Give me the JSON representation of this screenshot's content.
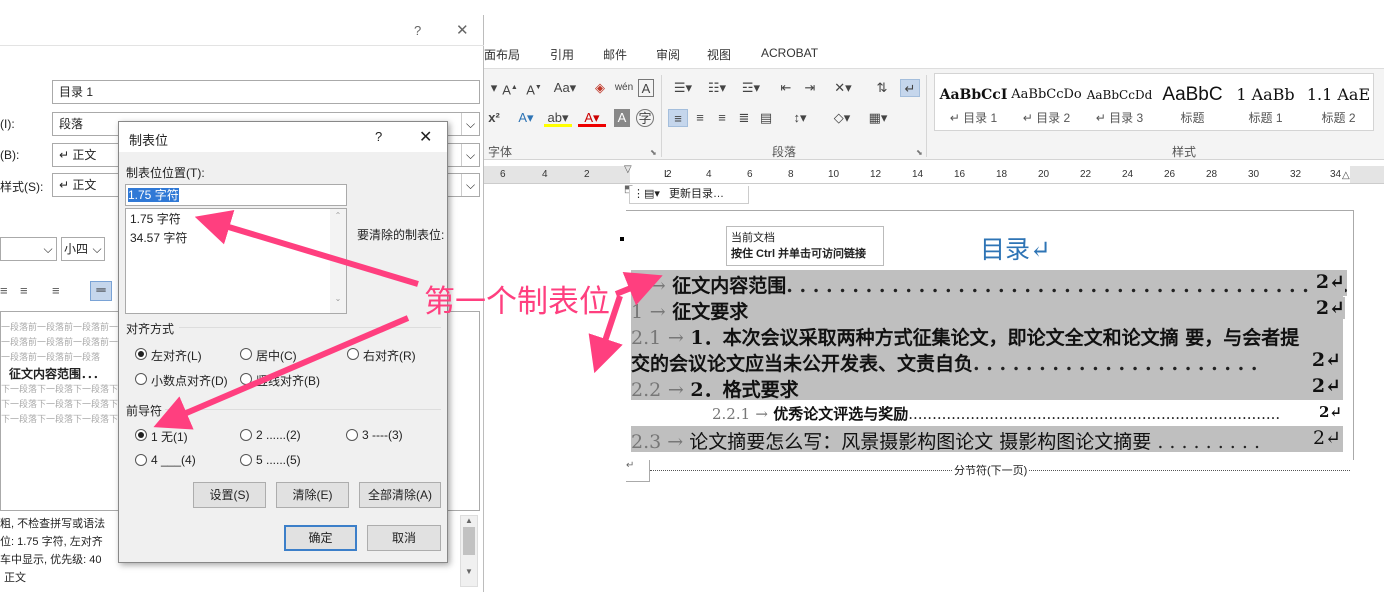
{
  "word": {
    "tabs": [
      "面布局",
      "引用",
      "邮件",
      "审阅",
      "视图",
      "ACROBAT"
    ],
    "group_labels": {
      "font": "字体",
      "paragraph": "段落",
      "styles": "样式"
    },
    "styles": [
      {
        "preview": "AaBbCcI",
        "name": "↵ 目录 1"
      },
      {
        "preview": "AaBbCcDo",
        "name": "↵ 目录 2"
      },
      {
        "preview": "AaBbCcDd",
        "name": "↵ 目录 3"
      },
      {
        "preview": "AaBbC",
        "name": "标题"
      },
      {
        "preview": "1 AaBb",
        "name": "标题 1"
      },
      {
        "preview": "1.1 AaE",
        "name": "标题 2"
      }
    ],
    "ruler_ticks": [
      "6",
      "4",
      "2",
      "2",
      "4",
      "6",
      "8",
      "10",
      "12",
      "14",
      "16",
      "18",
      "20",
      "22",
      "24",
      "26",
      "28",
      "30",
      "32",
      "34"
    ],
    "field_toolbar": "更新目录…",
    "tooltip_line1": "当前文档",
    "tooltip_line2": "按住 Ctrl 并单击可访问链接",
    "doc_title": "目录↵",
    "toc": [
      {
        "num": "1",
        "text": "征文内容范围",
        "page": "2↵"
      },
      {
        "num": "1",
        "text": "征文要求",
        "page": "2↵"
      },
      {
        "num": "2.1",
        "text": "1．本次会议采取两种方式征集论文，即论文全文和论文摘 要，与会者提",
        "page": ""
      },
      {
        "num": "",
        "text": "交的会议论文应当未公开发表、文责自负",
        "page": "2↵"
      },
      {
        "num": "2.2",
        "text": "2．格式要求",
        "page": "2↵"
      },
      {
        "num": "2.2.1",
        "text": "优秀论文评选与奖励",
        "page": "2↵"
      },
      {
        "num": "2.3",
        "text": "论文摘要怎么写：风景摄影构图论文 摄影构图论文摘要",
        "page": "2↵"
      }
    ],
    "section_break": "分节符(下一页)"
  },
  "para_dialog": {
    "help": "?",
    "close": "✕",
    "style_value": "目录 1",
    "label_type": "(I):",
    "type_value": "段落",
    "label_based": "(B):",
    "based_value": "↵ 正文",
    "label_next": "样式(S):",
    "next_value": "↵ 正文",
    "size_value": "小四",
    "preview_lines": [
      "一段落前一段落前一段落前一段落前一段落前",
      "一段落前一段落前一段落前一段落前一段落前",
      "一段落前一段落前一段落",
      "征文内容范围．．．",
      "下一段落下一段落下一段落下一段落下一段落",
      "下一段落下一段落下一段落下一段落下一段落",
      "下一段落下一段落下一段落下一段落下一段落"
    ],
    "desc_lines": [
      "粗, 不检查拼写或语法",
      "位: 1.75 字符, 左对齐",
      "车中显示, 优先级: 40",
      "正文"
    ]
  },
  "tab_dialog": {
    "title": "制表位",
    "help": "?",
    "close": "✕",
    "position_label": "制表位位置(T):",
    "position_value": "1.75 字符",
    "list": [
      "1.75 字符",
      "34.57 字符"
    ],
    "clear_label": "要清除的制表位:",
    "align_label": "对齐方式",
    "align": [
      {
        "label": "左对齐(L)",
        "selected": true
      },
      {
        "label": "居中(C)",
        "selected": false
      },
      {
        "label": "右对齐(R)",
        "selected": false
      },
      {
        "label": "小数点对齐(D)",
        "selected": false
      },
      {
        "label": "竖线对齐(B)",
        "selected": false
      }
    ],
    "leader_label": "前导符",
    "leaders": [
      {
        "label": "1 无(1)",
        "selected": true
      },
      {
        "label": "2 ......(2)",
        "selected": false
      },
      {
        "label": "3 ----(3)",
        "selected": false
      },
      {
        "label": "4 ___(4)",
        "selected": false
      },
      {
        "label": "5 ......(5)",
        "selected": false
      }
    ],
    "set_btn": "设置(S)",
    "clear_btn": "清除(E)",
    "clear_all_btn": "全部清除(A)",
    "ok_btn": "确定",
    "cancel_btn": "取消"
  },
  "annotation": "第一个制表位",
  "colors": {
    "annotation": "#ff3f7f",
    "toc_title": "#2e74b5",
    "highlight": "#bfbfbf"
  }
}
